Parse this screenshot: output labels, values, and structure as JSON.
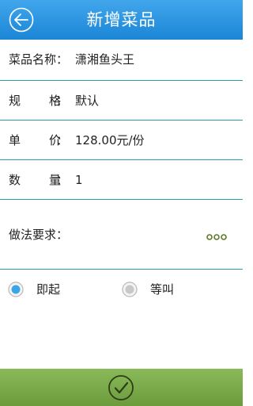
{
  "header": {
    "title": "新增菜品"
  },
  "form": {
    "dish_name_label": "菜品名称",
    "dish_name_value": "潇湘鱼头王",
    "spec_label_1": "规",
    "spec_label_2": "格",
    "spec_value": "默认",
    "price_label_1": "单",
    "price_label_2": "价",
    "price_value": "128.00元/份",
    "qty_label_1": "数",
    "qty_label_2": "量",
    "qty_value": "1",
    "method_label": "做法要求",
    "colon": "："
  },
  "serve_options": [
    {
      "label": "即起",
      "selected": true
    },
    {
      "label": "等叫",
      "selected": false
    }
  ],
  "colors": {
    "header": "#1b86d6",
    "divider": "#2a9bb0",
    "footer": "#7aab4a",
    "radio_selected": "#3aa6e6"
  }
}
